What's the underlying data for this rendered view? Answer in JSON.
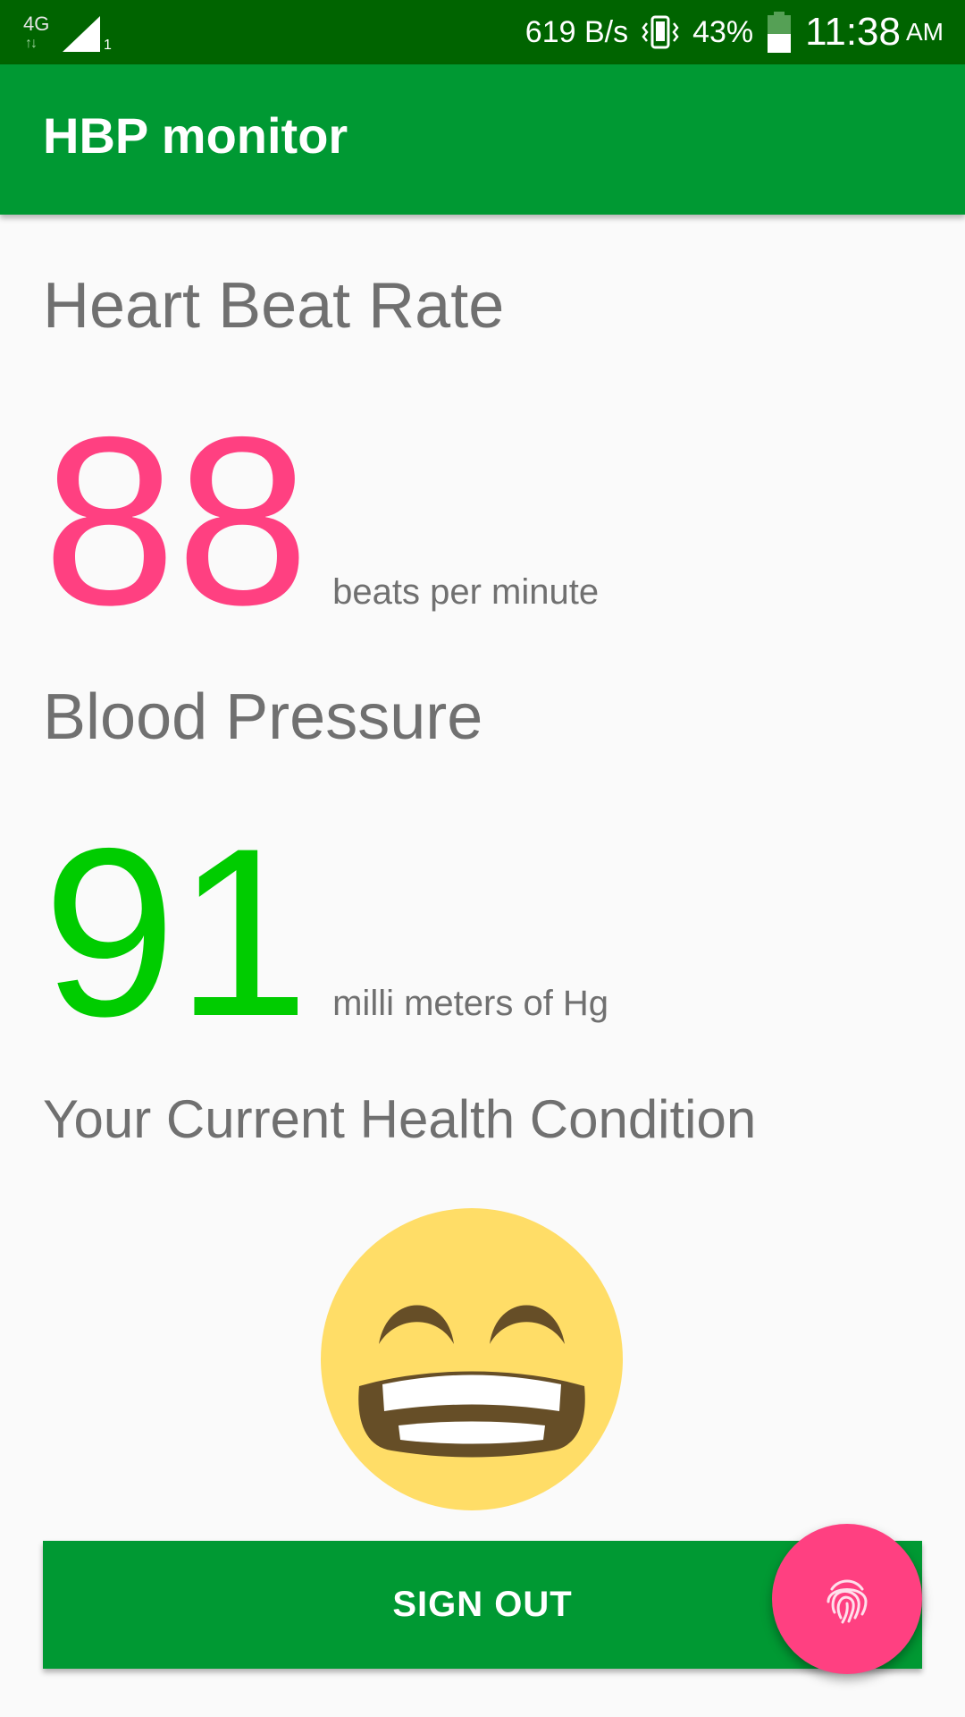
{
  "status_bar": {
    "network_type": "4G",
    "network_arrows": "↑↓",
    "sim_slot": "1",
    "data_speed": "619 B/s",
    "battery_percent": "43%",
    "time": "11:38",
    "am_pm": "AM"
  },
  "app_bar": {
    "title": "HBP monitor",
    "color": "#009933"
  },
  "heart_rate": {
    "title": "Heart Beat Rate",
    "value": "88",
    "unit": "beats per minute",
    "value_color": "#ff4081"
  },
  "blood_pressure": {
    "title": "Blood Pressure",
    "value": "91",
    "unit": "milli meters of Hg",
    "value_color": "#00cc00"
  },
  "health": {
    "title": "Your Current Health Condition",
    "emoji_icon": "grinning-face-icon"
  },
  "sign_out": {
    "label": "SIGN OUT"
  },
  "fab": {
    "icon": "fingerprint-icon",
    "color": "#ff4081"
  }
}
